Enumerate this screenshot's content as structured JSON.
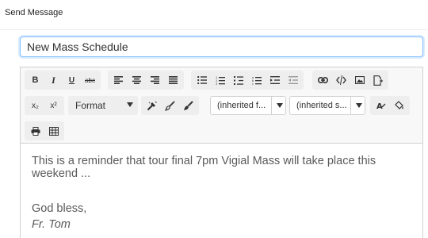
{
  "header": {
    "title": "Send Message"
  },
  "subject": {
    "value": "New Mass Schedule"
  },
  "toolbar": {
    "bold": "B",
    "italic": "I",
    "underline": "U",
    "strike": "abc",
    "subscript": "x₂",
    "superscript": "x²",
    "format_label": "Format",
    "font_family_value": "(inherited f...",
    "font_size_value": "(inherited s..."
  },
  "message": {
    "line1": "This is a reminder that tour final 7pm Vigial Mass will take place this weekend ...",
    "signoff": "God bless,",
    "signature": "Fr. Tom"
  },
  "icons": [
    "align-left-icon",
    "align-center-icon",
    "align-right-icon",
    "align-justify-icon",
    "bulleted-list-icon",
    "numbered-list-icon",
    "outline-list-icon",
    "lettered-list-icon",
    "indent-icon",
    "outdent-icon",
    "link-icon",
    "unlink-icon",
    "image-icon",
    "file-icon",
    "magic-wand-icon",
    "brush-icon",
    "format-painter-icon",
    "font-color-icon",
    "fill-color-icon",
    "print-icon",
    "table-icon"
  ]
}
